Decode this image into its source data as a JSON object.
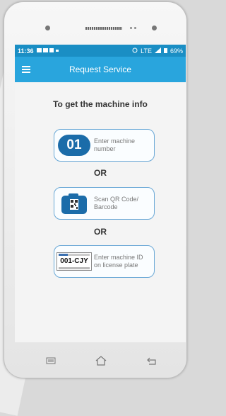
{
  "status_bar": {
    "time": "11:36",
    "right_text": "LTE",
    "battery": "69%"
  },
  "app_bar": {
    "title": "Request Service",
    "menu_icon": "hamburger-menu-icon"
  },
  "main": {
    "heading": "To get the machine info",
    "options": [
      {
        "icon_text": "01",
        "label_line1": "Enter machine",
        "label_line2": "number"
      },
      {
        "icon": "camera-qr-icon",
        "label_line1": "Scan QR Code/",
        "label_line2": "Barcode"
      },
      {
        "plate_id": "001-CJY",
        "label_line1": "Enter machine ID",
        "label_line2": "on license plate"
      }
    ],
    "or_label_1": "OR",
    "or_label_2": "OR"
  },
  "nav": {
    "menu_icon": "recent-apps-icon",
    "home_icon": "home-icon",
    "back_icon": "back-icon"
  },
  "colors": {
    "status_bar": "#1a8ec4",
    "app_bar": "#29a5dd",
    "badge": "#1b6ca9",
    "option_border": "#6aa8d6"
  }
}
